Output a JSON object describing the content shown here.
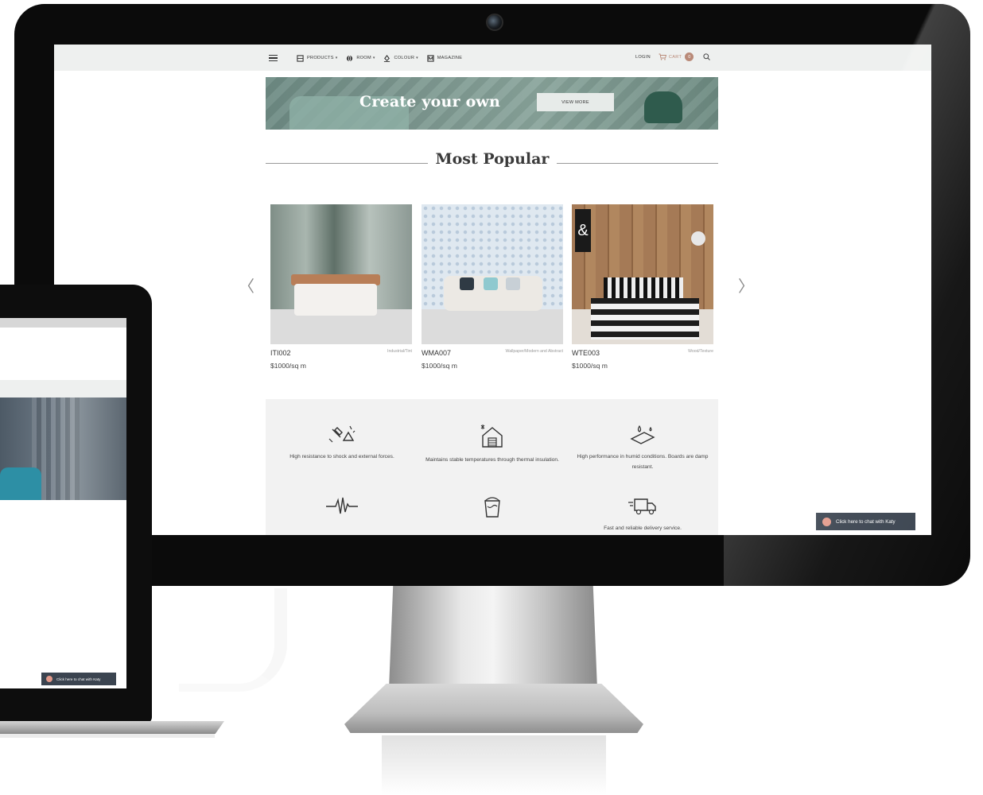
{
  "nav": {
    "items": [
      {
        "label": "PRODUCTS",
        "icon": "grid-icon",
        "has_dropdown": true
      },
      {
        "label": "ROOM",
        "icon": "globe-icon",
        "has_dropdown": true
      },
      {
        "label": "COLOUR",
        "icon": "paint-icon",
        "has_dropdown": true
      },
      {
        "label": "MAGAZINE",
        "icon": "magazine-icon",
        "has_dropdown": false
      }
    ],
    "login": "LOGIN",
    "cart_label": "CART",
    "cart_count": "0",
    "caret": "▾"
  },
  "banner": {
    "title": "Create your own",
    "button": "VIEW MORE"
  },
  "section": {
    "title": "Most Popular"
  },
  "carousel": {
    "prev": "〈",
    "next": "〉",
    "products": [
      {
        "code": "ITI002",
        "category": "Industrial/Tint",
        "price": "$1000/sq m"
      },
      {
        "code": "WMA007",
        "category": "Wallpaper/Modern and Abstract",
        "price": "$1000/sq m"
      },
      {
        "code": "WTE003",
        "category": "Wood/Texture",
        "price": "$1000/sq m"
      }
    ]
  },
  "features": [
    {
      "text": "High resistance to shock and external forces.",
      "icon": "hammer-icon"
    },
    {
      "text": "Maintains stable temperatures through thermal insulation.",
      "icon": "house-thermal-icon"
    },
    {
      "text": "High performance in humid conditions. Boards are damp resistant.",
      "icon": "water-drop-board-icon"
    },
    {
      "text": "",
      "icon": "sound-wave-icon"
    },
    {
      "text": "",
      "icon": "paint-bucket-icon"
    },
    {
      "text": "Fast and reliable delivery service.",
      "icon": "delivery-truck-icon"
    }
  ],
  "chat": {
    "label": "Click here to chat with Katy"
  },
  "laptop": {
    "chat_label": "Click here to chat with Katy"
  },
  "colors": {
    "accent": "#b98a78",
    "chat_bg": "#3b4450",
    "topbar_bg": "#eef0ef",
    "banner_bg": "#7f9a92"
  }
}
